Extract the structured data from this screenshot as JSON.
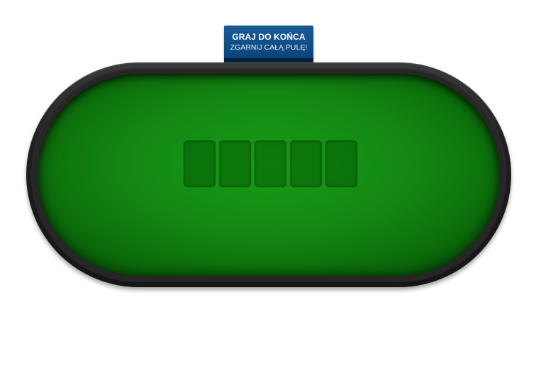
{
  "banner": {
    "title": "GRAJ DO KOŃCA",
    "subtitle": "ZGARNIJ CAŁĄ PULĘ!"
  },
  "table": {
    "felt_color": "#138612",
    "rail_color": "#1e1e1e",
    "card_slots": [
      {
        "label": "community-card-1"
      },
      {
        "label": "community-card-2"
      },
      {
        "label": "community-card-3"
      },
      {
        "label": "community-card-4"
      },
      {
        "label": "community-card-5"
      }
    ]
  }
}
